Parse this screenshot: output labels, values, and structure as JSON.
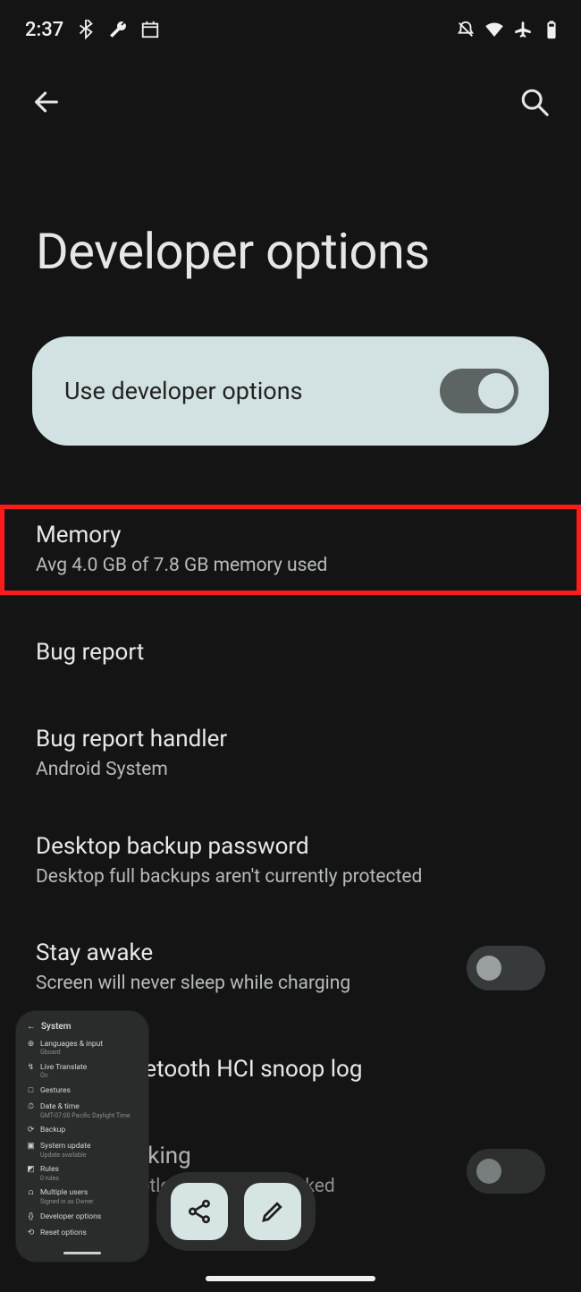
{
  "status": {
    "time": "2:37",
    "icons_left": [
      "bluetooth",
      "wrench",
      "calendar"
    ],
    "icons_right": [
      "dnd-off",
      "wifi",
      "airplane",
      "battery"
    ]
  },
  "page": {
    "title": "Developer options"
  },
  "master_toggle": {
    "label": "Use developer options",
    "on": true
  },
  "items": [
    {
      "title": "Memory",
      "sub": "Avg 4.0 GB of 7.8 GB memory used",
      "highlight": true
    },
    {
      "title": "Bug report"
    },
    {
      "title": "Bug report handler",
      "sub": "Android System"
    },
    {
      "title": "Desktop backup password",
      "sub": "Desktop full backups aren't currently protected"
    },
    {
      "title": "Stay awake",
      "sub": "Screen will never sleep while charging",
      "switch": false
    },
    {
      "title": "Enable Bluetooth HCI snoop log"
    },
    {
      "title": "OEM unlocking",
      "sub": "Allow the bootloader to be unlocked",
      "switch": false
    }
  ],
  "preview": {
    "header": "System",
    "rows": [
      {
        "icon": "⊕",
        "title": "Languages & input",
        "sub": "Gboard"
      },
      {
        "icon": "↯",
        "title": "Live Translate",
        "sub": "On"
      },
      {
        "icon": "□",
        "title": "Gestures",
        "sub": ""
      },
      {
        "icon": "⏱",
        "title": "Date & time",
        "sub": "GMT-07:00 Pacific Daylight Time"
      },
      {
        "icon": "⟳",
        "title": "Backup",
        "sub": ""
      },
      {
        "icon": "▣",
        "title": "System update",
        "sub": "Update available"
      },
      {
        "icon": "◩",
        "title": "Rules",
        "sub": "0 rules"
      },
      {
        "icon": "⩍",
        "title": "Multiple users",
        "sub": "Signed in as Owner"
      },
      {
        "icon": "{}",
        "title": "Developer options",
        "sub": ""
      },
      {
        "icon": "⟲",
        "title": "Reset options",
        "sub": ""
      }
    ]
  }
}
